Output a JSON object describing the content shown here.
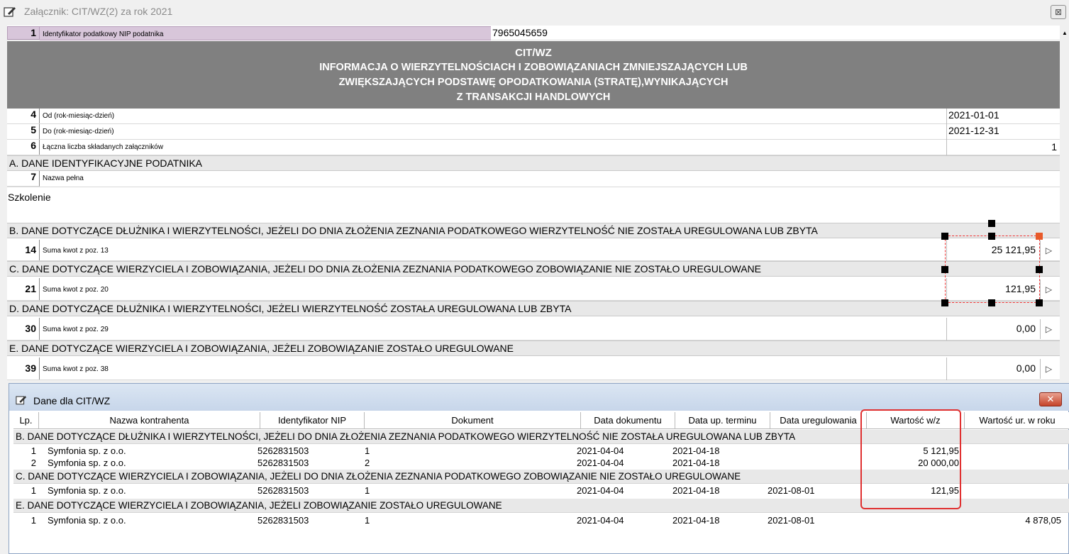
{
  "window": {
    "title": "Załącznik: CIT/WZ(2) za rok 2021",
    "close_glyph": "⊠"
  },
  "form": {
    "nip_row": {
      "num": "1",
      "label": "Identyfikator podatkowy NIP podatnika",
      "value": "7965045659"
    },
    "header_lines": [
      "CIT/WZ",
      "INFORMACJA O WIERZYTELNOŚCIACH I ZOBOWIĄZANIACH ZMNIEJSZAJĄCYCH LUB",
      "ZWIĘKSZAJĄCYCH PODSTAWĘ OPODATKOWANIA (STRATĘ),WYNIKAJĄCYCH",
      "Z TRANSAKCJI HANDLOWYCH"
    ],
    "row4": {
      "num": "4",
      "label": "Od (rok-miesiąc-dzień)",
      "value": "2021-01-01"
    },
    "row5": {
      "num": "5",
      "label": "Do (rok-miesiąc-dzień)",
      "value": "2021-12-31"
    },
    "row6": {
      "num": "6",
      "label": "Łączna liczba składanych załączników",
      "value": "1"
    },
    "section_a": "A. DANE IDENTYFIKACYJNE PODATNIKA",
    "row7": {
      "num": "7",
      "label": "Nazwa pełna",
      "value": "Szkolenie"
    },
    "section_b": "B. DANE DOTYCZĄCE DŁUŻNIKA I WIERZYTELNOŚCI, JEŻELI DO DNIA ZŁOŻENIA ZEZNANIA PODATKOWEGO WIERZYTELNOŚĆ NIE ZOSTAŁA UREGULOWANA LUB ZBYTA",
    "row14": {
      "num": "14",
      "label": "Suma kwot z poz. 13",
      "value": "25 121,95"
    },
    "section_c": "C. DANE DOTYCZĄCE WIERZYCIELA I ZOBOWIĄZANIA, JEŻELI DO DNIA ZŁOŻENIA ZEZNANIA PODATKOWEGO ZOBOWIĄZANIE NIE ZOSTAŁO UREGULOWANE",
    "row21": {
      "num": "21",
      "label": "Suma kwot z poz. 20",
      "value": "121,95"
    },
    "section_d": "D. DANE DOTYCZĄCE DŁUŻNIKA I WIERZYTELNOŚCI, JEŻELI WIERZYTELNOŚĆ ZOSTAŁA UREGULOWANA LUB ZBYTA",
    "row30": {
      "num": "30",
      "label": "Suma kwot z poz. 29",
      "value": "0,00"
    },
    "section_e": "E. DANE DOTYCZĄCE WIERZYCIELA I ZOBOWIĄZANIA, JEŻELI ZOBOWIĄZANIE ZOSTAŁO UREGULOWANE",
    "row39": {
      "num": "39",
      "label": "Suma kwot z poz. 38",
      "value": "0,00"
    },
    "arrow_glyph": "▷"
  },
  "dialog": {
    "title": "Dane dla CIT/WZ",
    "close_glyph": "✕",
    "columns": [
      "Lp.",
      "Nazwa kontrahenta",
      "Identyfikator NIP",
      "Dokument",
      "Data dokumentu",
      "Data up. terminu",
      "Data uregulowania",
      "Wartość w/z",
      "Wartość ur. w roku"
    ],
    "section_b": "B. DANE DOTYCZĄCE DŁUŻNIKA I WIERZYTELNOŚCI, JEŻELI DO DNIA ZŁOŻENIA ZEZNANIA PODATKOWEGO WIERZYTELNOŚĆ NIE ZOSTAŁA UREGULOWANA LUB ZBYTA",
    "section_c": "C. DANE DOTYCZĄCE WIERZYCIELA I ZOBOWIĄZANIA, JEŻELI DO DNIA ZŁOŻENIA ZEZNANIA PODATKOWEGO ZOBOWIĄZANIE NIE ZOSTAŁO UREGULOWANE",
    "section_e": "E. DANE DOTYCZĄCE WIERZYCIELA I ZOBOWIĄZANIA, JEŻELI ZOBOWIĄZANIE ZOSTAŁO UREGULOWANE",
    "rows_b": [
      {
        "lp": "1",
        "name": "Symfonia sp. z o.o.",
        "nip": "5262831503",
        "doc": "1",
        "date_doc": "2021-04-04",
        "date_due": "2021-04-18",
        "date_paid": "",
        "value": "5 121,95",
        "value_year": ""
      },
      {
        "lp": "2",
        "name": "Symfonia sp. z o.o.",
        "nip": "5262831503",
        "doc": "2",
        "date_doc": "2021-04-04",
        "date_due": "2021-04-18",
        "date_paid": "",
        "value": "20 000,00",
        "value_year": ""
      }
    ],
    "rows_c": [
      {
        "lp": "1",
        "name": "Symfonia sp. z o.o.",
        "nip": "5262831503",
        "doc": "1",
        "date_doc": "2021-04-04",
        "date_due": "2021-04-18",
        "date_paid": "2021-08-01",
        "value": "121,95",
        "value_year": ""
      }
    ],
    "rows_e": [
      {
        "lp": "1",
        "name": "Symfonia sp. z o.o.",
        "nip": "5262831503",
        "doc": "1",
        "date_doc": "2021-04-04",
        "date_due": "2021-04-18",
        "date_paid": "2021-08-01",
        "value": "",
        "value_year": "4 878,05"
      }
    ]
  }
}
